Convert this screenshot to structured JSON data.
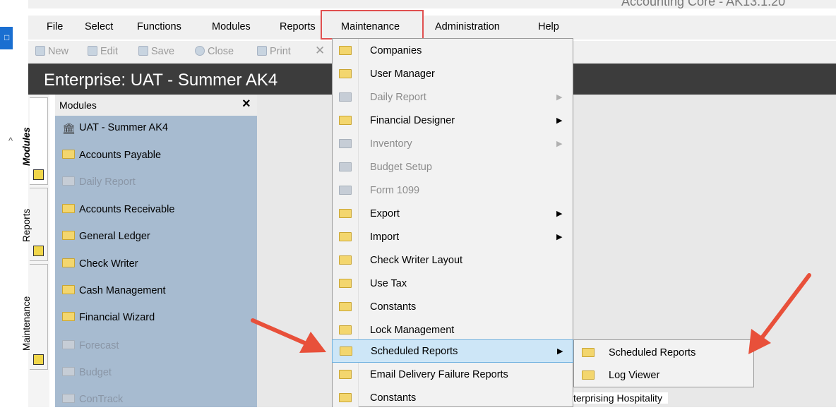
{
  "window": {
    "title": "Accounting Core - AK13.1.20"
  },
  "menu": {
    "items": [
      "File",
      "Select",
      "Functions",
      "Modules",
      "Reports",
      "Maintenance",
      "Administration",
      "Help"
    ]
  },
  "toolbar": {
    "buttons": [
      "New",
      "Edit",
      "Save",
      "Close",
      "Print"
    ]
  },
  "enterprise": {
    "title": "Enterprise: UAT - Summer AK4"
  },
  "side_tabs": [
    "Modules",
    "Reports",
    "Maintenance"
  ],
  "modules_panel": {
    "title": "Modules",
    "close": "×",
    "root": "UAT - Summer AK4",
    "items": [
      {
        "label": "Accounts Payable",
        "enabled": true
      },
      {
        "label": "Daily Report",
        "enabled": false
      },
      {
        "label": "Accounts Receivable",
        "enabled": true
      },
      {
        "label": "General Ledger",
        "enabled": true
      },
      {
        "label": "Check Writer",
        "enabled": true
      },
      {
        "label": "Cash Management",
        "enabled": true
      },
      {
        "label": "Financial Wizard",
        "enabled": true
      },
      {
        "label": "Forecast",
        "enabled": false
      },
      {
        "label": "Budget",
        "enabled": false
      },
      {
        "label": "ConTrack",
        "enabled": false
      }
    ]
  },
  "maintenance_menu": {
    "items": [
      {
        "label": "Companies",
        "enabled": true,
        "submenu": false
      },
      {
        "label": "User Manager",
        "enabled": true,
        "submenu": false
      },
      {
        "label": "Daily Report",
        "enabled": false,
        "submenu": true
      },
      {
        "label": "Financial Designer",
        "enabled": true,
        "submenu": true
      },
      {
        "label": "Inventory",
        "enabled": false,
        "submenu": true
      },
      {
        "label": "Budget Setup",
        "enabled": false,
        "submenu": false
      },
      {
        "label": "Form 1099",
        "enabled": false,
        "submenu": false
      },
      {
        "label": "Export",
        "enabled": true,
        "submenu": true
      },
      {
        "label": "Import",
        "enabled": true,
        "submenu": true
      },
      {
        "label": "Check Writer Layout",
        "enabled": true,
        "submenu": false
      },
      {
        "label": "Use Tax",
        "enabled": true,
        "submenu": false
      },
      {
        "label": "Constants",
        "enabled": true,
        "submenu": false
      },
      {
        "label": "Lock Management",
        "enabled": true,
        "submenu": false
      },
      {
        "label": "Scheduled Reports",
        "enabled": true,
        "submenu": true,
        "selected": true
      },
      {
        "label": "Email Delivery Failure Reports",
        "enabled": true,
        "submenu": false
      },
      {
        "label": "Constants",
        "enabled": true,
        "submenu": false
      }
    ]
  },
  "scheduled_reports_submenu": {
    "items": [
      "Scheduled Reports",
      "Log Viewer"
    ]
  },
  "footer": {
    "text": "terprising Hospitality"
  },
  "colors": {
    "highlight_box": "#e05050",
    "annotation_arrow": "#e8503a",
    "selected_item": "#cde6f7"
  }
}
